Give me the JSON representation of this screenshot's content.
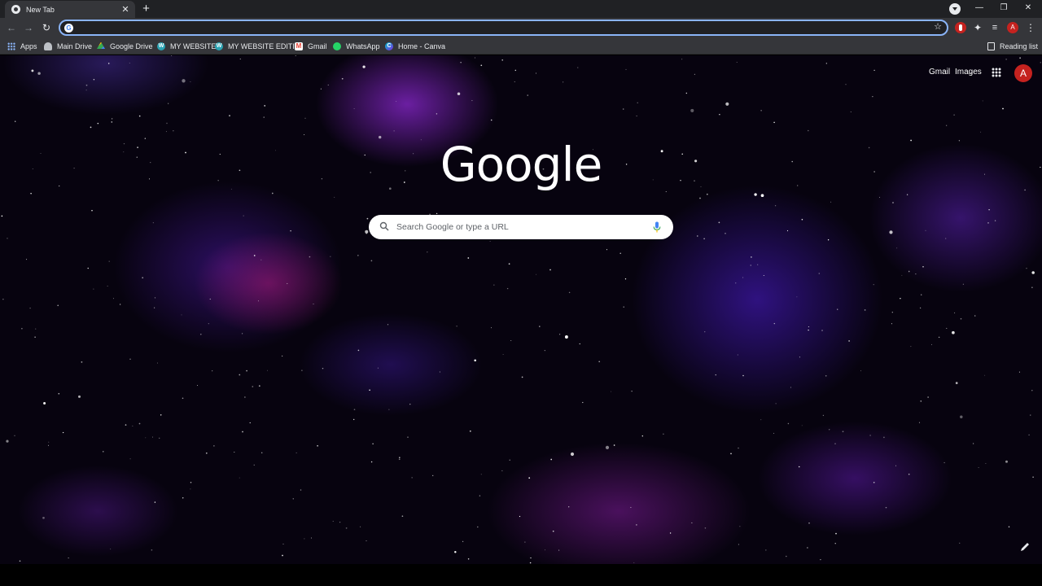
{
  "tab": {
    "title": "New Tab",
    "close": "✕"
  },
  "tabstrip": {
    "new_tab": "+",
    "minimize": "—",
    "restore": "❐",
    "close": "✕"
  },
  "toolbar": {
    "back": "←",
    "forward": "→",
    "reload": "↻",
    "star": "☆",
    "puzzle": "✦",
    "queue": "≡",
    "avatar_letter": "A",
    "menu": "⋮"
  },
  "omnibox": {
    "value": "",
    "g": "G"
  },
  "bookmarks": [
    {
      "label": "Apps",
      "icon": "apps-grid-icon"
    },
    {
      "label": "Main Drive",
      "icon": "main-drive-icon"
    },
    {
      "label": "Google Drive",
      "icon": "google-drive-icon"
    },
    {
      "label": "MY WEBSITE",
      "icon": "wordpress-icon",
      "glyph": "W"
    },
    {
      "label": "MY WEBSITE EDITI...",
      "icon": "wordpress-icon",
      "glyph": "W"
    },
    {
      "label": "Gmail",
      "icon": "gmail-icon",
      "glyph": "M"
    },
    {
      "label": "WhatsApp",
      "icon": "whatsapp-icon"
    },
    {
      "label": "Home - Canva",
      "icon": "canva-icon",
      "glyph": "C"
    }
  ],
  "reading_list": "Reading list",
  "ntp": {
    "gmail": "Gmail",
    "images": "Images",
    "avatar_letter": "A",
    "logo": "Google",
    "search_placeholder": "Search Google or type a URL"
  },
  "colors": {
    "accent": "#8ab4f8",
    "toolbar": "#35363a",
    "tabstrip": "#202124",
    "avatar": "#c5221f"
  }
}
